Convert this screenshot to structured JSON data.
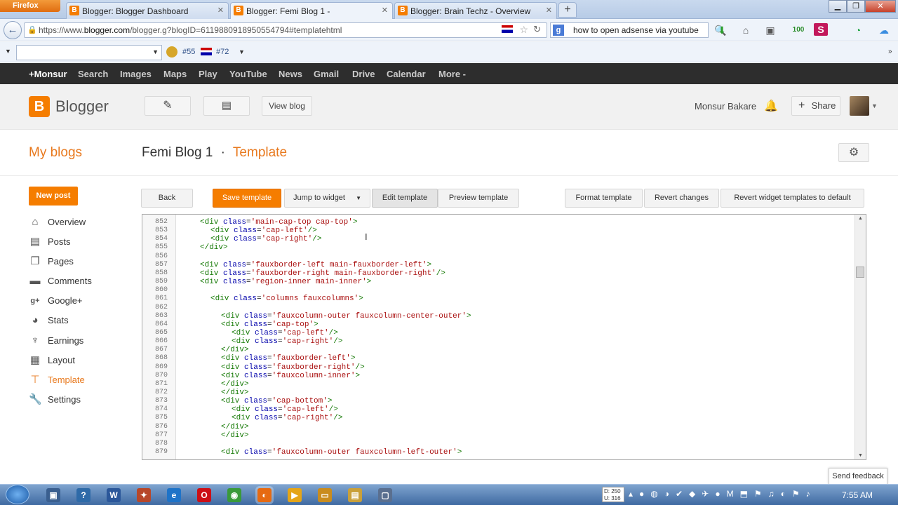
{
  "browser": {
    "menu_label": "Firefox",
    "tabs": [
      {
        "title": "Blogger: Blogger Dashboard",
        "active": false
      },
      {
        "title": "Blogger: Femi Blog 1 -",
        "active": true
      },
      {
        "title": "Blogger: Brain Techz - Overview",
        "active": false
      }
    ],
    "new_tab": "+",
    "url_prefix": "https://www.",
    "url_domain": "blogger.com",
    "url_rest": "/blogger.g?blogID=6119880918950554794#templatehtml",
    "search_value": "how to open adsense via youtube",
    "addon_counter_1": "#55",
    "addon_counter_2": "#72",
    "accent": "#f57d00"
  },
  "google_bar": {
    "items": [
      "+Monsur",
      "Search",
      "Images",
      "Maps",
      "Play",
      "YouTube",
      "News",
      "Gmail",
      "Drive",
      "Calendar",
      "More -"
    ]
  },
  "header": {
    "brand": "Blogger",
    "view_blog": "View blog",
    "user": "Monsur Bakare",
    "share": "Share"
  },
  "page": {
    "my_blogs": "My blogs",
    "blog_name": "Femi Blog 1",
    "separator": "·",
    "section": "Template"
  },
  "sidebar": {
    "new_post": "New post",
    "items": [
      {
        "label": "Overview",
        "icon": "home-icon"
      },
      {
        "label": "Posts",
        "icon": "posts-icon"
      },
      {
        "label": "Pages",
        "icon": "pages-icon"
      },
      {
        "label": "Comments",
        "icon": "comment-icon"
      },
      {
        "label": "Google+",
        "icon": "google-plus-icon"
      },
      {
        "label": "Stats",
        "icon": "stats-icon"
      },
      {
        "label": "Earnings",
        "icon": "trophy-icon"
      },
      {
        "label": "Layout",
        "icon": "layout-icon"
      },
      {
        "label": "Template",
        "icon": "template-icon"
      },
      {
        "label": "Settings",
        "icon": "wrench-icon"
      }
    ],
    "selected": "Template"
  },
  "toolbar": {
    "back": "Back",
    "save": "Save template",
    "jump": "Jump to widget",
    "edit": "Edit template",
    "preview": "Preview template",
    "format": "Format template",
    "revert": "Revert changes",
    "revert_widgets": "Revert widget templates to default"
  },
  "editor": {
    "lines": [
      {
        "n": "852",
        "indent": 0,
        "code": "<div class='main-cap-top cap-top'>"
      },
      {
        "n": "853",
        "indent": 1,
        "code": "<div class='cap-left'/>"
      },
      {
        "n": "854",
        "indent": 1,
        "code": "<div class='cap-right'/>"
      },
      {
        "n": "855",
        "indent": 0,
        "code": "</div>"
      },
      {
        "n": "856",
        "indent": 0,
        "code": ""
      },
      {
        "n": "857",
        "indent": 0,
        "code": "<div class='fauxborder-left main-fauxborder-left'>"
      },
      {
        "n": "858",
        "indent": 0,
        "code": "<div class='fauxborder-right main-fauxborder-right'/>"
      },
      {
        "n": "859",
        "indent": 0,
        "code": "<div class='region-inner main-inner'>"
      },
      {
        "n": "860",
        "indent": 0,
        "code": ""
      },
      {
        "n": "861",
        "indent": 1,
        "code": "<div class='columns fauxcolumns'>"
      },
      {
        "n": "862",
        "indent": 0,
        "code": ""
      },
      {
        "n": "863",
        "indent": 2,
        "code": "<div class='fauxcolumn-outer fauxcolumn-center-outer'>"
      },
      {
        "n": "864",
        "indent": 2,
        "code": "<div class='cap-top'>"
      },
      {
        "n": "865",
        "indent": 3,
        "code": "<div class='cap-left'/>"
      },
      {
        "n": "866",
        "indent": 3,
        "code": "<div class='cap-right'/>"
      },
      {
        "n": "867",
        "indent": 2,
        "code": "</div>"
      },
      {
        "n": "868",
        "indent": 2,
        "code": "<div class='fauxborder-left'>"
      },
      {
        "n": "869",
        "indent": 2,
        "code": "<div class='fauxborder-right'/>"
      },
      {
        "n": "870",
        "indent": 2,
        "code": "<div class='fauxcolumn-inner'>"
      },
      {
        "n": "871",
        "indent": 2,
        "code": "</div>"
      },
      {
        "n": "872",
        "indent": 2,
        "code": "</div>"
      },
      {
        "n": "873",
        "indent": 2,
        "code": "<div class='cap-bottom'>"
      },
      {
        "n": "874",
        "indent": 3,
        "code": "<div class='cap-left'/>"
      },
      {
        "n": "875",
        "indent": 3,
        "code": "<div class='cap-right'/>"
      },
      {
        "n": "876",
        "indent": 2,
        "code": "</div>"
      },
      {
        "n": "877",
        "indent": 2,
        "code": "</div>"
      },
      {
        "n": "878",
        "indent": 0,
        "code": ""
      },
      {
        "n": "879",
        "indent": 2,
        "code": "<div class='fauxcolumn-outer fauxcolumn-left-outer'>"
      }
    ]
  },
  "feedback": "Send feedback",
  "taskbar": {
    "tray_d": "D: 250",
    "tray_u": "U: 316",
    "clock": "7:55 AM"
  }
}
